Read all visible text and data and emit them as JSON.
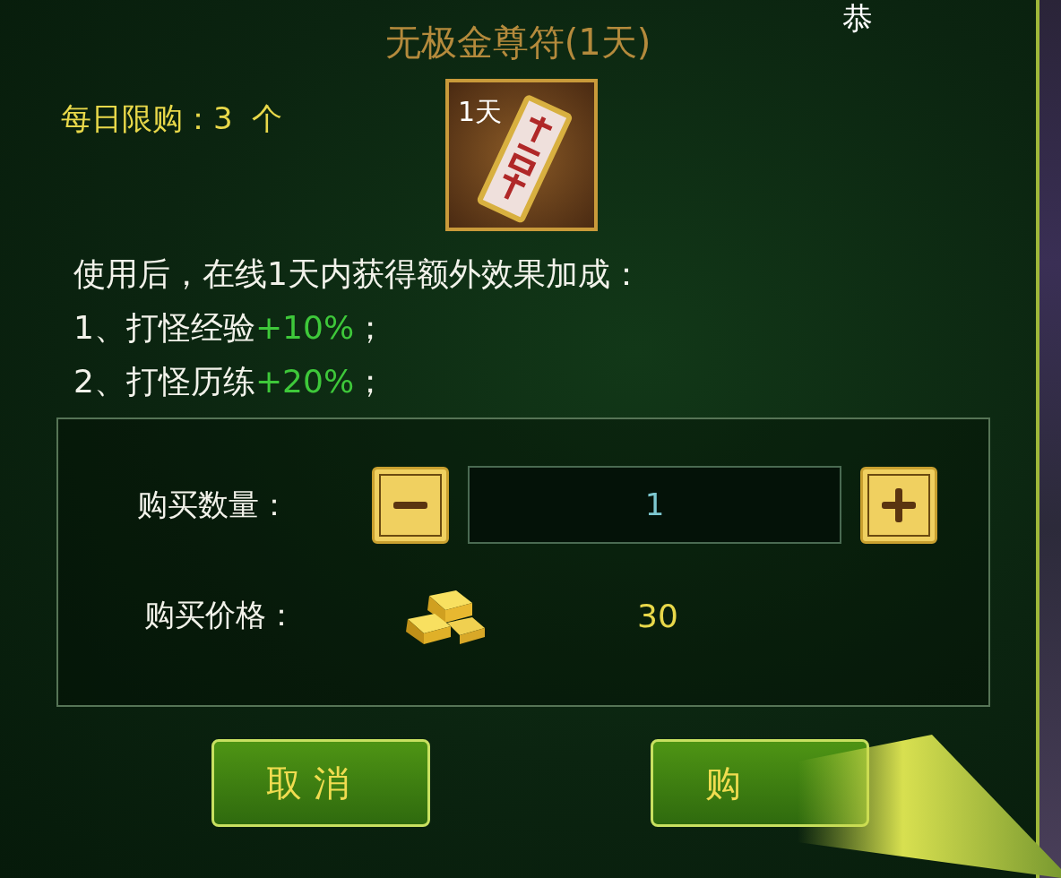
{
  "title": "无极金尊符(1天)",
  "corner_text": "恭",
  "daily_limit": {
    "label": "每日限购：",
    "count": "3",
    "unit": "个"
  },
  "item": {
    "badge": "1天"
  },
  "description": {
    "intro": "使用后，在线1天内获得额外效果加成：",
    "effects": [
      {
        "index": "1、",
        "name": "打怪经验",
        "bonus": "+10%",
        "end": "；"
      },
      {
        "index": "2、",
        "name": "打怪历练",
        "bonus": "+20%",
        "end": "；"
      }
    ]
  },
  "purchase": {
    "quantity_label": "购买数量：",
    "quantity": "1",
    "price_label": "购买价格：",
    "price": "30"
  },
  "buttons": [
    {
      "label": "取 消",
      "kind": "cancel"
    },
    {
      "label": "购",
      "kind": "confirm"
    }
  ]
}
